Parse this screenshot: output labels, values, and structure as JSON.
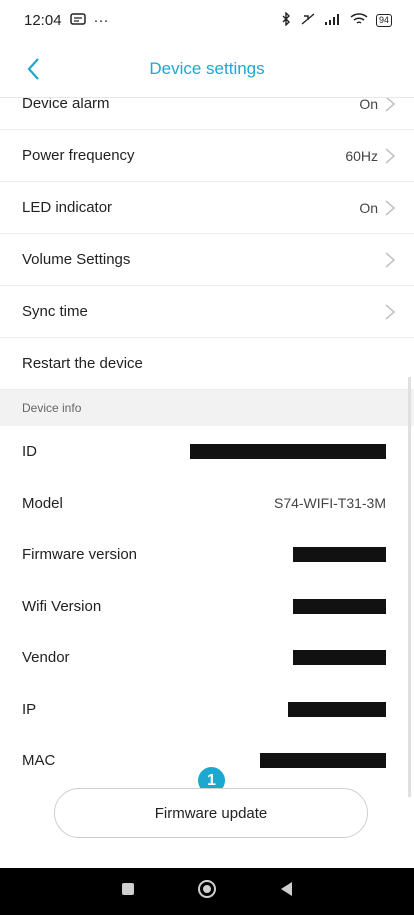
{
  "status_bar": {
    "time": "12:04",
    "extra": "···",
    "right_icons": "✱ ⁰ .ıl",
    "battery": "94"
  },
  "header": {
    "title": "Device settings"
  },
  "settings_rows": [
    {
      "label": "Device alarm",
      "value": "On",
      "chevron": true
    },
    {
      "label": "Power frequency",
      "value": "60Hz",
      "chevron": true
    },
    {
      "label": "LED indicator",
      "value": "On",
      "chevron": true
    },
    {
      "label": "Volume Settings",
      "value": "",
      "chevron": true
    },
    {
      "label": "Sync time",
      "value": "",
      "chevron": true
    },
    {
      "label": "Restart the device",
      "value": "",
      "chevron": false
    }
  ],
  "device_info": {
    "section_title": "Device info",
    "rows": [
      {
        "label": "ID",
        "value": "",
        "redacted": true
      },
      {
        "label": "Model",
        "value": "S74-WIFI-T31-3M",
        "redacted": false
      },
      {
        "label": "Firmware version",
        "value": "",
        "redacted": true
      },
      {
        "label": "Wifi Version",
        "value": "",
        "redacted": true
      },
      {
        "label": "Vendor",
        "value": "",
        "redacted": true
      },
      {
        "label": "IP",
        "value": "",
        "redacted": true
      },
      {
        "label": "MAC",
        "value": "",
        "redacted": true
      }
    ]
  },
  "annotation_badge": "1",
  "firmware_update_label": "Firmware update",
  "colors": {
    "accent": "#1da8cf",
    "section_bg": "#f2f2f2",
    "nav_bar": "#000000"
  }
}
